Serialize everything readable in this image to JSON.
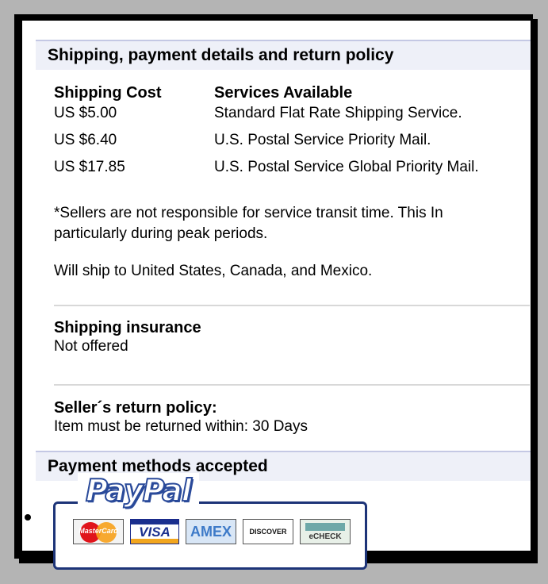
{
  "shipping_section": {
    "header": "Shipping, payment details and return policy",
    "columns": {
      "cost": "Shipping Cost",
      "services": "Services Available"
    },
    "rows": [
      {
        "cost": "US $5.00",
        "service": "Standard Flat Rate Shipping Service."
      },
      {
        "cost": "US $6.40",
        "service": "U.S. Postal Service Priority Mail."
      },
      {
        "cost": "US $17.85",
        "service": "U.S. Postal Service Global Priority Mail."
      }
    ],
    "note_line1": "*Sellers are not responsible for service transit time. This In",
    "note_line2": "particularly during peak periods.",
    "ship_to": "Will ship to United States, Canada, and Mexico."
  },
  "insurance": {
    "title": "Shipping insurance",
    "value": "Not offered"
  },
  "return_policy": {
    "title": "Seller´s return policy:",
    "value": "Item must be returned within: 30 Days"
  },
  "payment_section": {
    "header": "Payment methods accepted",
    "paypal_logo": "PayPal",
    "cards": {
      "mastercard": "MasterCard",
      "visa": "VISA",
      "amex": "AMEX",
      "discover": "DISCOVER",
      "echeck": "eCHECK"
    }
  },
  "colors": {
    "section_header_bg": "#eef0f8",
    "paypal_blue": "#1d3478",
    "frame": "#000000"
  }
}
